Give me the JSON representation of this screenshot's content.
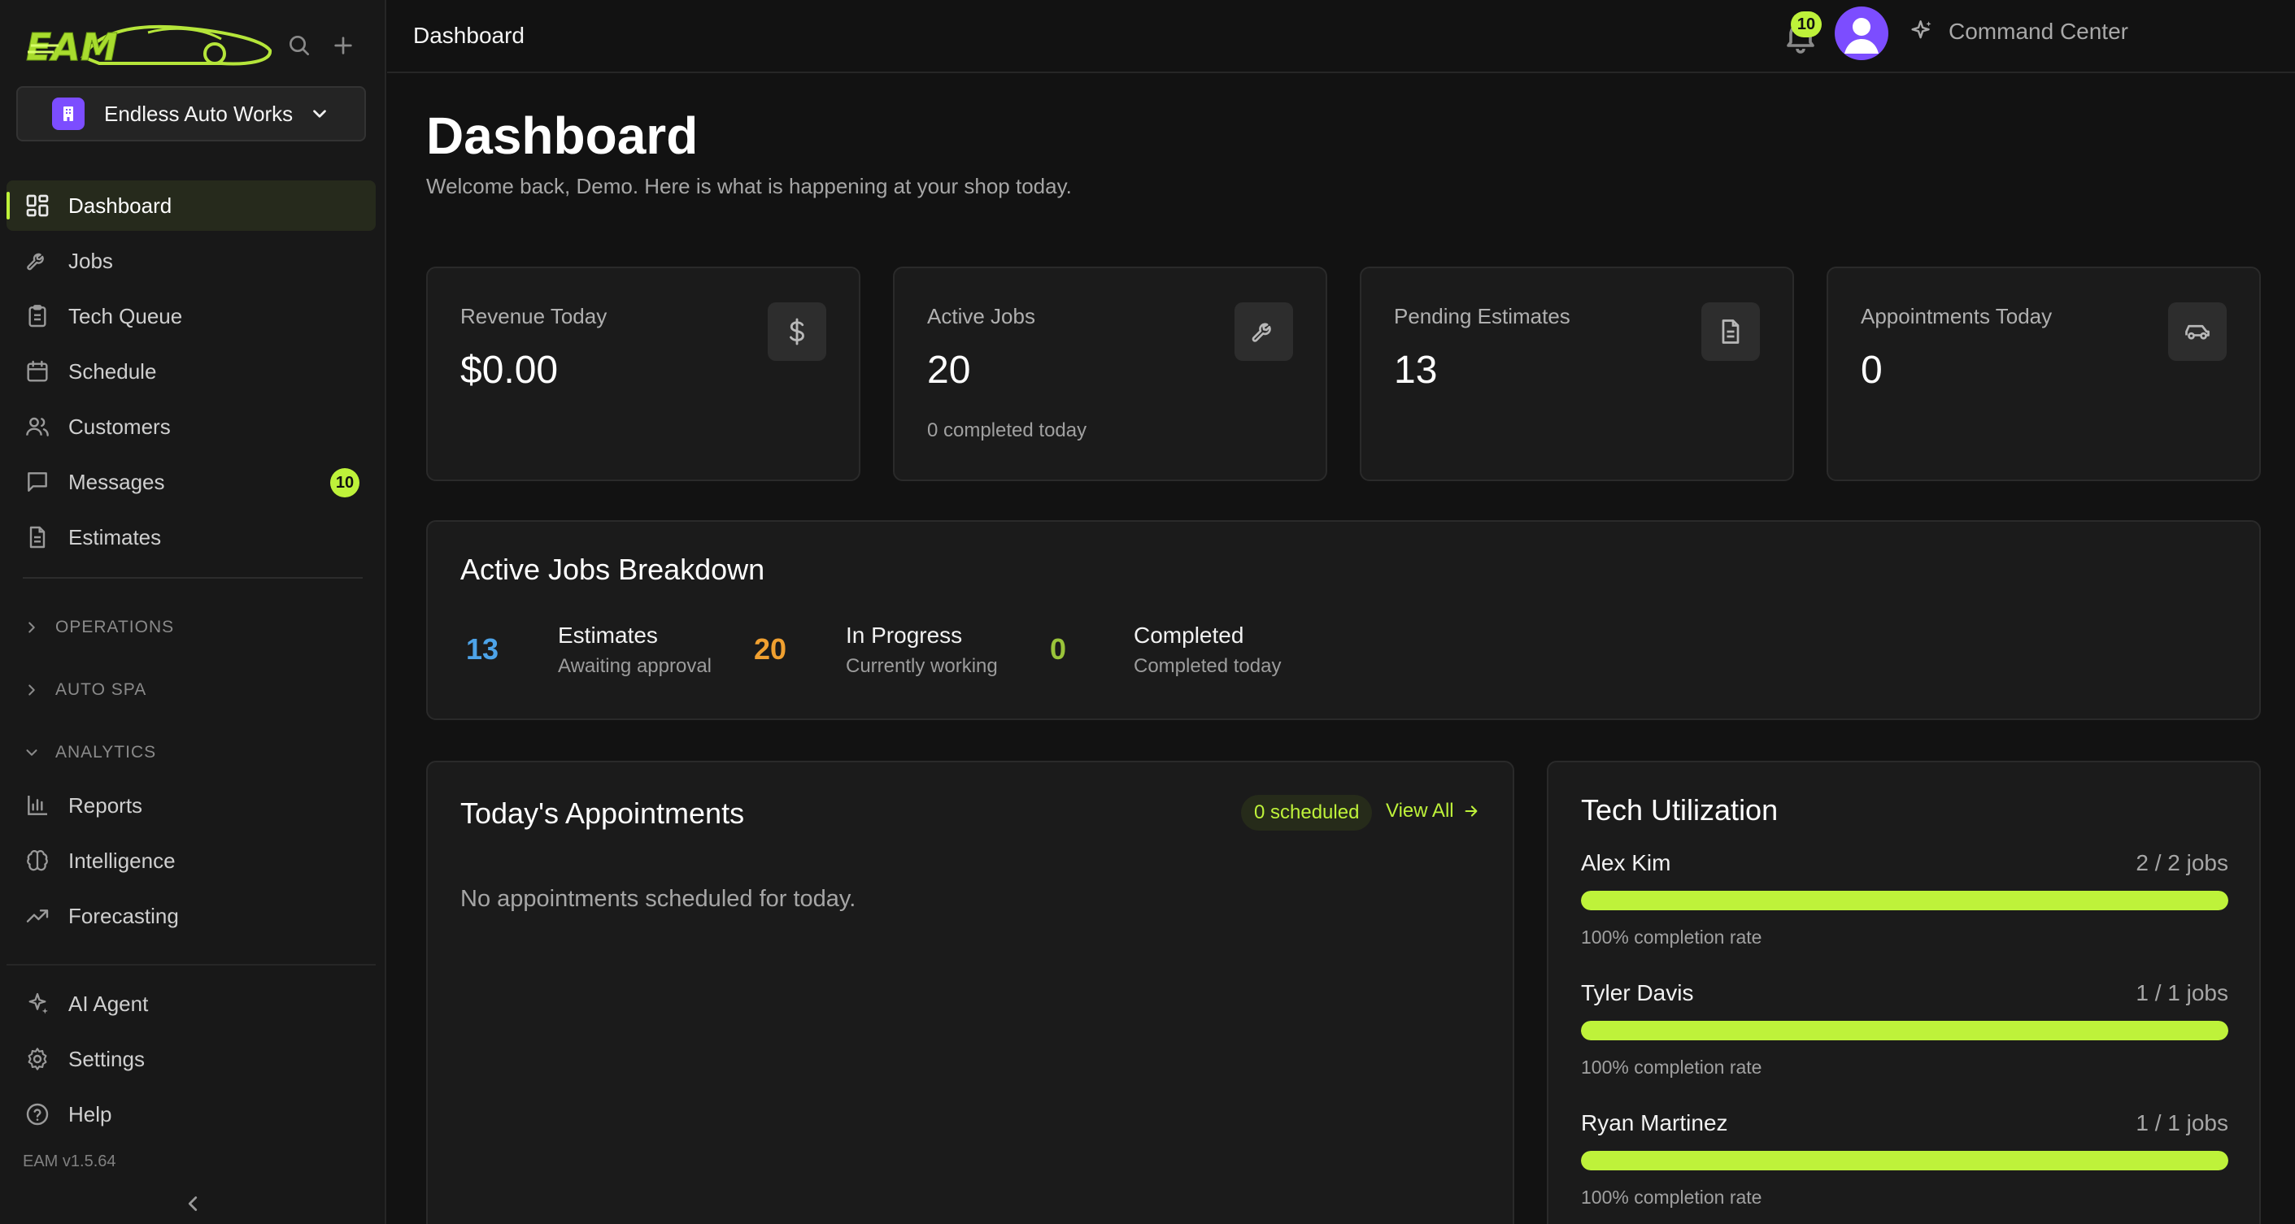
{
  "sidebar": {
    "shop_name": "Endless Auto Works",
    "nav": [
      {
        "label": "Dashboard",
        "icon": "dashboard-icon",
        "active": true
      },
      {
        "label": "Jobs",
        "icon": "wrench-icon"
      },
      {
        "label": "Tech Queue",
        "icon": "clipboard-icon"
      },
      {
        "label": "Schedule",
        "icon": "calendar-icon"
      },
      {
        "label": "Customers",
        "icon": "users-icon"
      },
      {
        "label": "Messages",
        "icon": "message-icon",
        "badge": "10"
      },
      {
        "label": "Estimates",
        "icon": "document-icon"
      }
    ],
    "sections": {
      "operations": "OPERATIONS",
      "auto_spa": "AUTO SPA",
      "analytics": "ANALYTICS"
    },
    "analytics_nav": [
      {
        "label": "Reports",
        "icon": "bar-chart-icon"
      },
      {
        "label": "Intelligence",
        "icon": "brain-icon"
      },
      {
        "label": "Forecasting",
        "icon": "trend-up-icon"
      }
    ],
    "bottom_nav": [
      {
        "label": "AI Agent",
        "icon": "sparkle-icon"
      },
      {
        "label": "Settings",
        "icon": "gear-icon"
      },
      {
        "label": "Help",
        "icon": "help-icon"
      }
    ],
    "version": "EAM v1.5.64"
  },
  "topbar": {
    "title": "Dashboard",
    "command_center": "Command Center",
    "notification_count": "10"
  },
  "page": {
    "title": "Dashboard",
    "subtitle": "Welcome back, Demo. Here is what is happening at your shop today."
  },
  "stats": [
    {
      "label": "Revenue Today",
      "value": "$0.00",
      "sub": "",
      "icon": "dollar-icon"
    },
    {
      "label": "Active Jobs",
      "value": "20",
      "sub": "0 completed today",
      "icon": "wrench-icon"
    },
    {
      "label": "Pending Estimates",
      "value": "13",
      "sub": "",
      "icon": "document-icon"
    },
    {
      "label": "Appointments Today",
      "value": "0",
      "sub": "",
      "icon": "car-icon"
    }
  ],
  "breakdown": {
    "title": "Active Jobs Breakdown",
    "items": [
      {
        "count": "13",
        "label": "Estimates",
        "sub": "Awaiting approval",
        "color": "#4da3e8"
      },
      {
        "count": "20",
        "label": "In Progress",
        "sub": "Currently working",
        "color": "#f0a030"
      },
      {
        "count": "0",
        "label": "Completed",
        "sub": "Completed today",
        "color": "#9ac43a"
      }
    ]
  },
  "appointments": {
    "title": "Today's Appointments",
    "scheduled": "0 scheduled",
    "view_all": "View All",
    "empty": "No appointments scheduled for today."
  },
  "tech_utilization": {
    "title": "Tech Utilization",
    "techs": [
      {
        "name": "Alex Kim",
        "jobs": "2 / 2 jobs",
        "rate": "100% completion rate",
        "fill": 1.0
      },
      {
        "name": "Tyler Davis",
        "jobs": "1 / 1 jobs",
        "rate": "100% completion rate",
        "fill": 1.0
      },
      {
        "name": "Ryan Martinez",
        "jobs": "1 / 1 jobs",
        "rate": "100% completion rate",
        "fill": 1.0
      }
    ]
  },
  "colors": {
    "accent": "#bef23a",
    "brand": "#7c4dff"
  }
}
